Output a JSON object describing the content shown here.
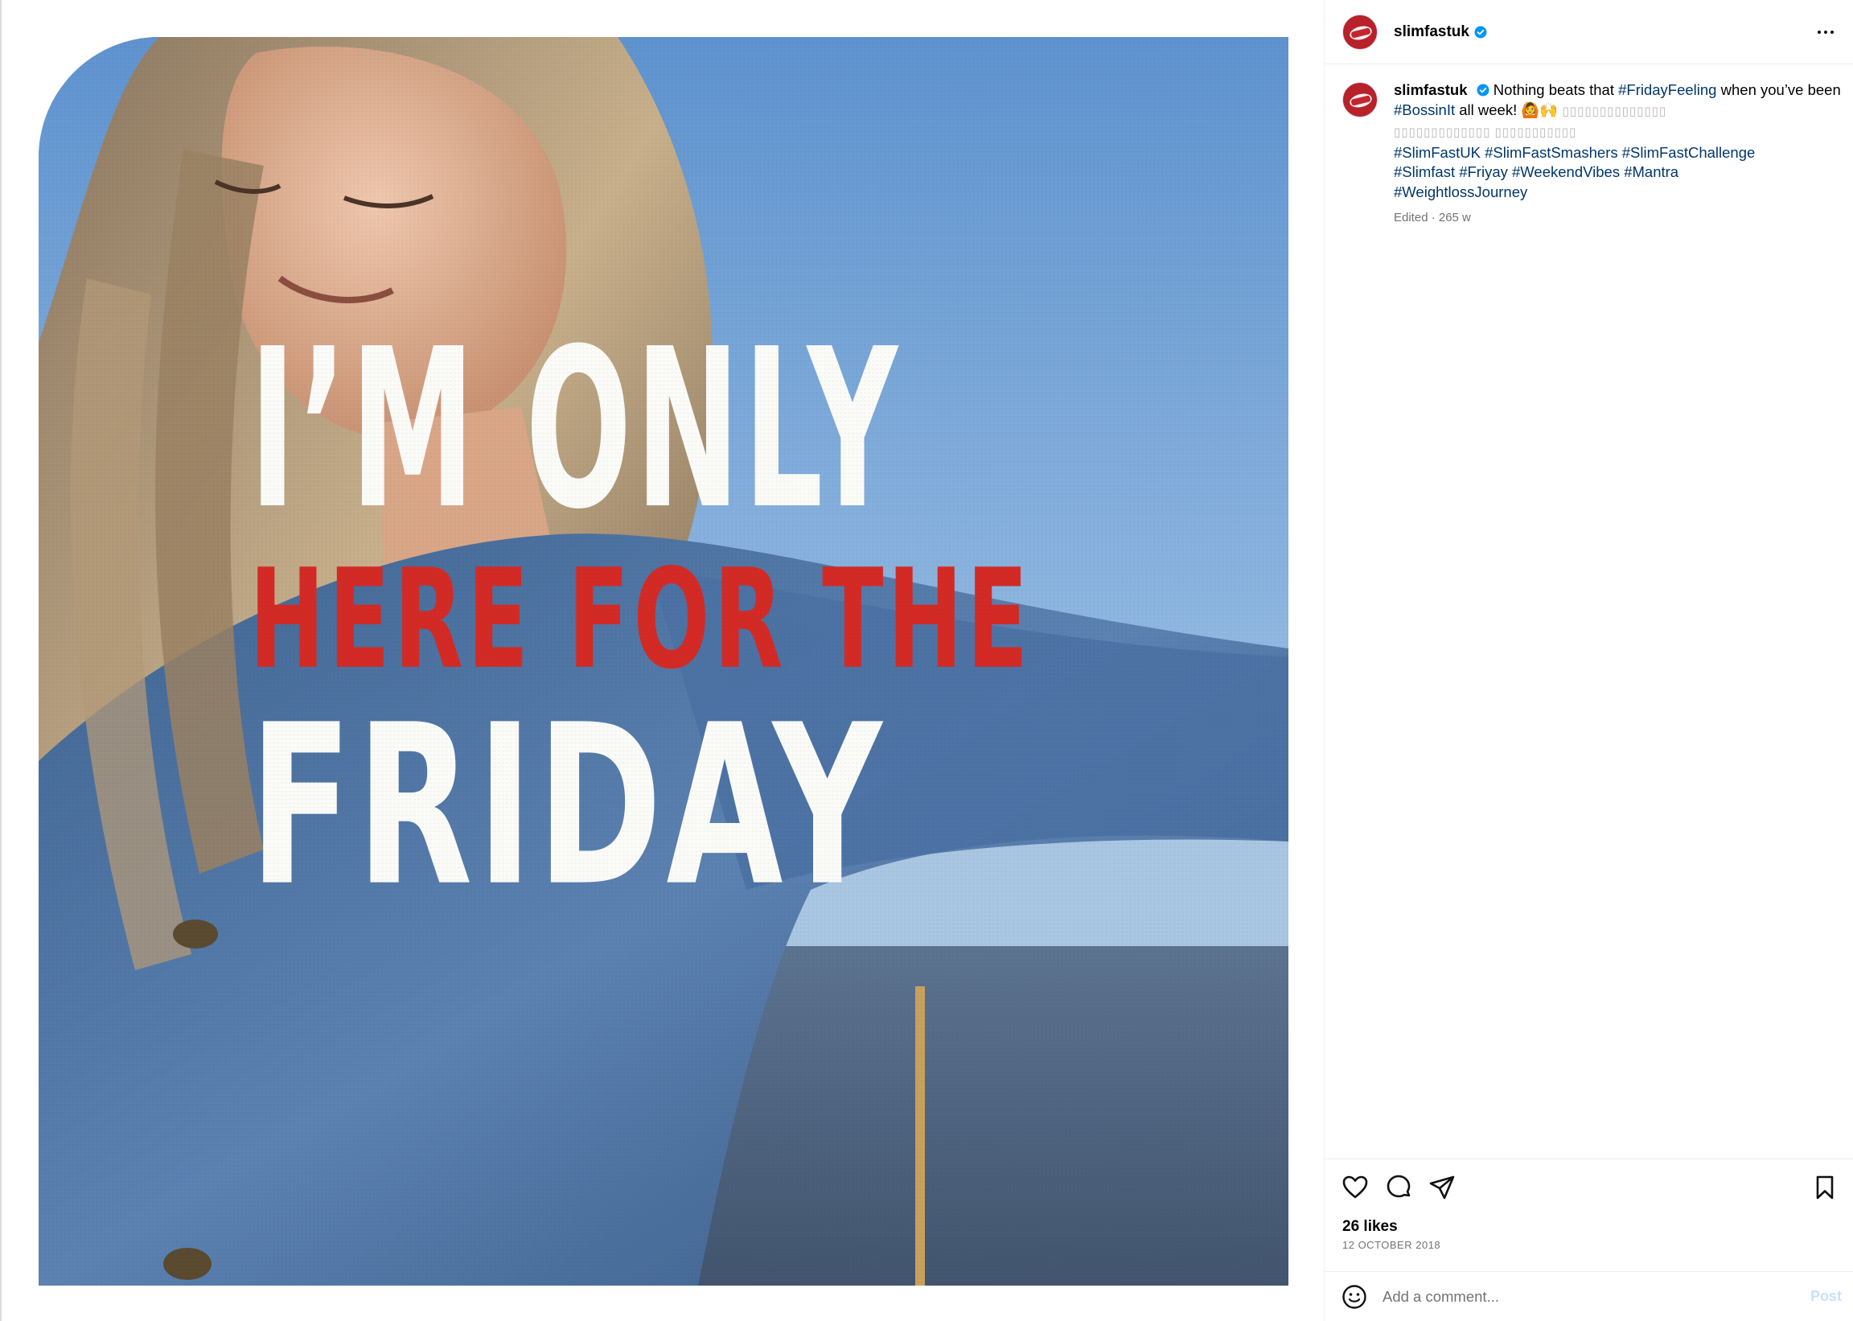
{
  "post": {
    "image_text": {
      "line1": "I’M ONLY",
      "line2": "HERE FOR THE",
      "line3": "FRIDAY"
    }
  },
  "header": {
    "username": "slimfastuk",
    "more_icon": "more-horizontal-icon"
  },
  "caption": {
    "username": "slimfastuk",
    "text_1": "Nothing beats that",
    "hashtag_1": "#FridayFeeling",
    "text_2": "when you’ve been",
    "hashtag_2": "#BossinIt",
    "text_3": "all week! 🙆🙌",
    "placeholder_1": "▯▯▯▯▯▯▯▯▯▯▯▯▯▯",
    "placeholder_2": "▯▯▯▯▯▯▯▯▯▯▯▯▯ ▯▯▯▯▯▯▯▯▯▯▯",
    "hashtags": [
      "#SlimFastUK",
      "#SlimFastSmashers",
      "#SlimFastChallenge",
      "#Slimfast",
      "#Friyay",
      "#WeekendVibes",
      "#Mantra",
      "#WeightlossJourney"
    ],
    "meta": "Edited · 265 w"
  },
  "actions": {
    "like_icon": "heart-icon",
    "comment_icon": "comment-icon",
    "share_icon": "send-icon",
    "save_icon": "bookmark-icon"
  },
  "stats": {
    "likes": "26 likes",
    "date": "12 OCTOBER 2018"
  },
  "comment": {
    "placeholder": "Add a comment...",
    "post_label": "Post",
    "emoji_icon": "emoji-icon"
  },
  "colors": {
    "hashtag": "#00376b",
    "verified": "#0095f6",
    "brand_red": "#d42a25",
    "post_button_disabled": "#c7e1fc"
  }
}
